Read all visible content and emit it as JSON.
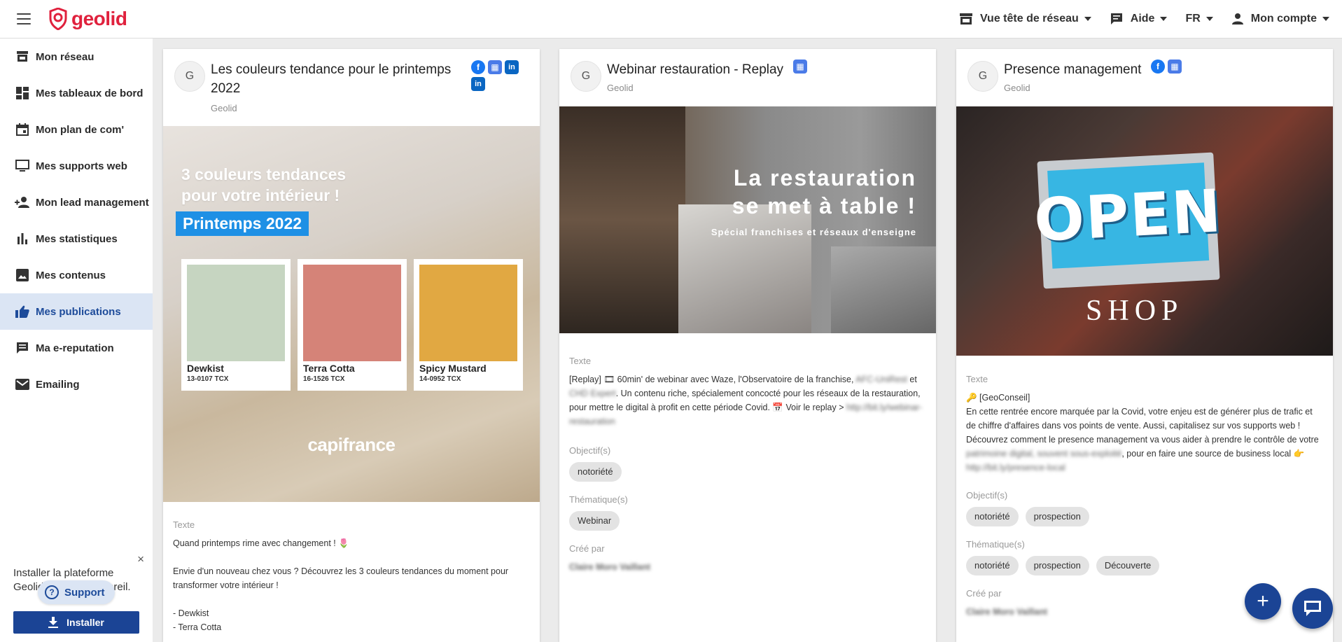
{
  "brand": {
    "name": "geolid",
    "color": "#e0213d"
  },
  "header": {
    "network_view": "Vue tête de réseau",
    "help": "Aide",
    "language": "FR",
    "account": "Mon compte"
  },
  "sidebar": {
    "items": [
      {
        "label": "Mon réseau",
        "icon": "store-icon"
      },
      {
        "label": "Mes tableaux de bord",
        "icon": "dashboard-icon"
      },
      {
        "label": "Mon plan de com'",
        "icon": "calendar-icon"
      },
      {
        "label": "Mes supports web",
        "icon": "monitor-icon"
      },
      {
        "label": "Mon lead management",
        "icon": "person-add-icon"
      },
      {
        "label": "Mes statistiques",
        "icon": "bar-chart-icon"
      },
      {
        "label": "Mes contenus",
        "icon": "image-icon"
      },
      {
        "label": "Mes publications",
        "icon": "thumb-up-icon",
        "active": true
      },
      {
        "label": "Ma e-reputation",
        "icon": "comment-icon"
      },
      {
        "label": "Emailing",
        "icon": "mail-icon"
      }
    ],
    "install": {
      "text": "Installer la plateforme Geolid sur votre appareil.",
      "support": "Support",
      "button": "Installer",
      "close": "×"
    }
  },
  "cards": [
    {
      "avatar": "G",
      "title": "Les couleurs tendance pour le printemps 2022",
      "author": "Geolid",
      "image": {
        "title_line1": "3 couleurs tendances",
        "title_line2": "pour votre intérieur !",
        "badge": "Printemps 2022",
        "swatches": [
          {
            "name": "Dewkist",
            "code": "13-0107 TCX",
            "color": "#c6d5c1"
          },
          {
            "name": "Terra Cotta",
            "code": "16-1526 TCX",
            "color": "#d58378"
          },
          {
            "name": "Spicy Mustard",
            "code": "14-0952 TCX",
            "color": "#e1a842"
          }
        ],
        "brand": "capifrance"
      },
      "text_label": "Texte",
      "text": "Quand printemps rime avec changement ! 🌷\n\nEnvie d'un nouveau chez vous ? Découvrez les 3 couleurs tendances du moment pour transformer votre intérieur !\n\n- Dewkist\n- Terra Cotta"
    },
    {
      "avatar": "G",
      "title": "Webinar restauration - Replay",
      "author": "Geolid",
      "image": {
        "line1": "La restauration",
        "line2": "se met à table !",
        "subtitle": "Spécial franchises et réseaux d'enseigne"
      },
      "text_label": "Texte",
      "text_a": "[Replay] 🎞 60min' de webinar avec Waze, l'Observatoire de la franchise, ",
      "text_blur1": "AFC-UniRest",
      "text_b": " et ",
      "text_blur2": "CHD Expert",
      "text_c": ". Un contenu riche, spécialement concocté pour les réseaux de la restauration, pour mettre le digital à profit en cette période Covid. 📅 Voir le replay > ",
      "text_blur3": "http://bit.ly/webinar-restauration",
      "objectives_label": "Objectif(s)",
      "objectives": [
        "notoriété"
      ],
      "themes_label": "Thématique(s)",
      "themes": [
        "Webinar"
      ],
      "created_label": "Créé par",
      "created_by": "Claire Moro Vaillant"
    },
    {
      "avatar": "G",
      "title": "Presence management",
      "author": "Geolid",
      "image": {
        "open": "OPEN",
        "shop": "SHOP"
      },
      "text_label": "Texte",
      "text_tag": "🔑 [GeoConseil]",
      "text_a": "En cette rentrée encore marquée par la Covid, votre enjeu est de générer plus de trafic et de chiffre d'affaires dans vos points de vente. Aussi, capitalisez sur vos supports web ! Découvrez comment le presence management va vous aider à prendre le contrôle de votre ",
      "text_blur1": "patrimoine digital, souvent sous-exploité",
      "text_b": ", pour en faire une source de business local 👉 ",
      "text_blur2": "http://bit.ly/presence-local",
      "objectives_label": "Objectif(s)",
      "objectives": [
        "notoriété",
        "prospection"
      ],
      "themes_label": "Thématique(s)",
      "themes": [
        "notoriété",
        "prospection",
        "Découverte"
      ],
      "created_label": "Créé par",
      "created_by": "Claire Moro Vaillant"
    }
  ],
  "fab": "+",
  "colors": {
    "primary": "#1b4495",
    "active_bg": "#dbe5f4"
  }
}
